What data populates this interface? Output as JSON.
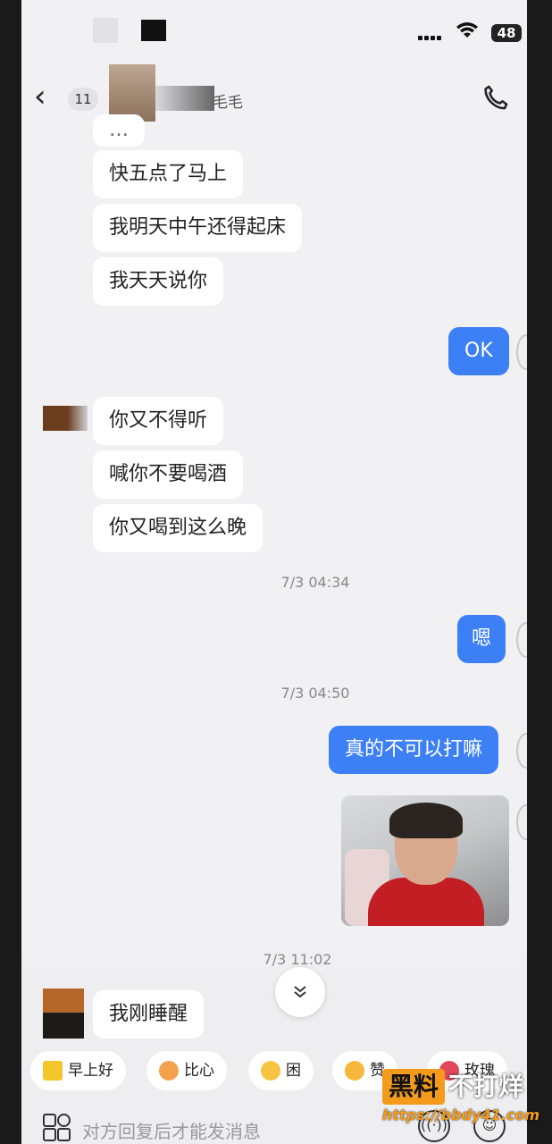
{
  "status_bar": {
    "battery": "48",
    "wifi_icon": "wifi-icon",
    "signal_icon": "signal-icon"
  },
  "nav": {
    "unread_count": "11",
    "contact_name": "毛毛",
    "back_icon": "chevron-left-icon",
    "call_icon": "phone-icon"
  },
  "messages": [
    {
      "side": "left",
      "text": "快五点了马上"
    },
    {
      "side": "left",
      "text": "我明天中午还得起床"
    },
    {
      "side": "left",
      "text": "我天天说你"
    },
    {
      "side": "right",
      "text": "OK"
    },
    {
      "side": "left",
      "text": "你又不得听"
    },
    {
      "side": "left",
      "text": "喊你不要喝酒"
    },
    {
      "side": "left",
      "text": "你又喝到这么晚"
    },
    {
      "side": "time",
      "text": "7/3 04:34"
    },
    {
      "side": "right",
      "text": "嗯"
    },
    {
      "side": "time",
      "text": "7/3 04:50"
    },
    {
      "side": "right",
      "text": "真的不可以打嘛"
    },
    {
      "side": "right",
      "type": "image"
    },
    {
      "side": "time",
      "text": "7/3 11:02"
    },
    {
      "side": "left",
      "text": "我刚睡醒"
    }
  ],
  "quick_replies": [
    {
      "label": "早上好",
      "icon": "sun-icon"
    },
    {
      "label": "比心",
      "icon": "heart-hand-icon"
    },
    {
      "label": "困",
      "icon": "sleepy-face-icon"
    },
    {
      "label": "赞",
      "icon": "thumbs-up-icon"
    },
    {
      "label": "玫瑰",
      "icon": "rose-icon"
    }
  ],
  "input": {
    "placeholder": "对方回复后才能发消息"
  },
  "watermark": {
    "box": "黑料",
    "text": "不打烊",
    "url": "https://bbdy41.com"
  },
  "colors": {
    "my_bubble": "#3d80f5",
    "their_bubble": "#ffffff",
    "background": "#f1f1f3",
    "watermark": "#f49b1c"
  }
}
